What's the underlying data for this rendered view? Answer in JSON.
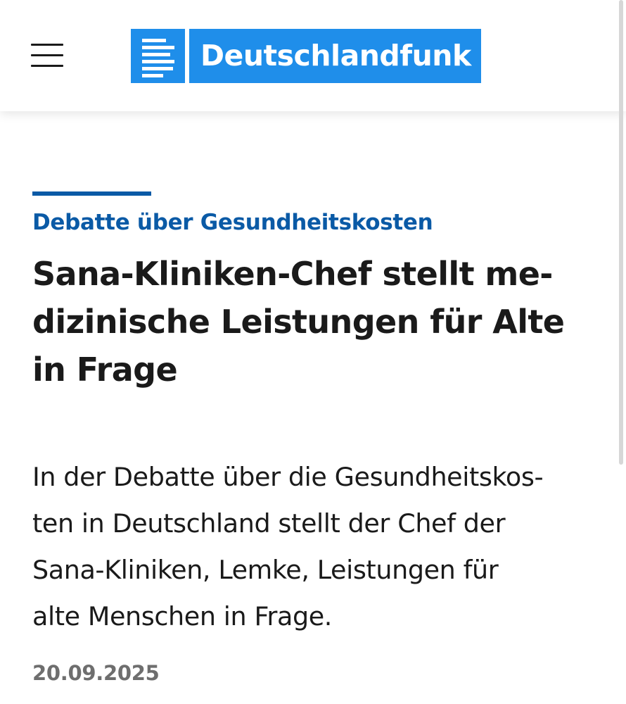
{
  "header": {
    "menu_icon": "hamburger-menu-icon",
    "logo_text": "Deutschlandfunk",
    "logo_icon": "deutschlandfunk-logo-icon",
    "logo_color": "#1f8eea"
  },
  "article": {
    "kicker": "Debatte über Gesundheitskosten",
    "headline_lines": [
      "Sana-Kliniken-Chef stellt me-",
      "dizinische Leistungen für Alte",
      "in Frage"
    ],
    "teaser_lines": [
      "In der Debatte über die Gesundheitskos-",
      "ten in Deutschland stellt der Chef der",
      "Sana-Kliniken, Lemke, Leistungen für",
      "alte Menschen in Frage."
    ],
    "date": "20.09.2025",
    "accent_color": "#0a5aa6"
  }
}
